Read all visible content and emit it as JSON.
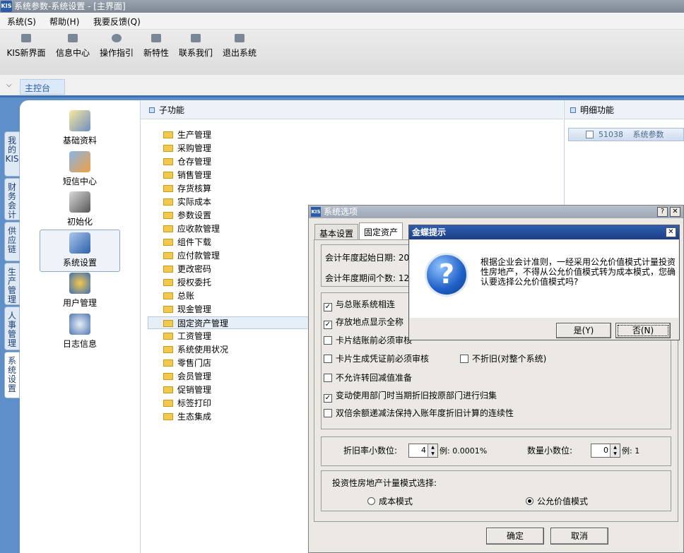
{
  "window": {
    "title": "系统参数-系统设置 - [主界面]",
    "logo": "KIS"
  },
  "menu": [
    "系统(S)",
    "帮助(H)",
    "我要反馈(Q)"
  ],
  "toolbar": [
    "KIS新界面",
    "信息中心",
    "操作指引",
    "新特性",
    "联系我们",
    "退出系统"
  ],
  "main_tab": "主控台",
  "vertical_tabs": [
    "我的KIS",
    "财务会计",
    "供应链",
    "生产管理",
    "人事管理",
    "系统设置"
  ],
  "nav_items": [
    "基础资料",
    "短信中心",
    "初始化",
    "系统设置",
    "用户管理",
    "日志信息"
  ],
  "sub_function": {
    "header": "子功能",
    "folders": [
      "生产管理",
      "采购管理",
      "仓存管理",
      "销售管理",
      "存货核算",
      "实际成本",
      "参数设置",
      "应收款管理",
      "组件下载",
      "应付款管理",
      "更改密码",
      "授权委托",
      "总账",
      "现金管理",
      "固定资产管理",
      "工资管理",
      "系统使用状况",
      "零售门店",
      "会员管理",
      "促销管理",
      "标签打印",
      "生态集成"
    ],
    "selected": "固定资产管理"
  },
  "detail": {
    "header": "明细功能",
    "item_code": "51038",
    "item_label": "系统参数"
  },
  "options_dialog": {
    "title": "系统选项",
    "logo": "KIS",
    "tabs": [
      "基本设置",
      "固定资产"
    ],
    "start_date_label": "会计年度起始日期: 20",
    "period_count_label": "会计年度期间个数: 12",
    "checkboxes": [
      {
        "label": "与总账系统相连",
        "checked": true
      },
      {
        "label": "存放地点显示全称",
        "checked": true
      },
      {
        "label": "卡片结账前必须审核",
        "checked": false
      },
      {
        "label": "卡片生成凭证前必须审核",
        "checked": false
      },
      {
        "label": "不折旧(对整个系统)",
        "checked": false
      },
      {
        "label": "不允许转回减值准备",
        "checked": false
      },
      {
        "label": "变动使用部门时当期折旧按原部门进行归集",
        "checked": true
      },
      {
        "label": "双倍余额递减法保持入账年度折旧计算的连续性",
        "checked": false
      }
    ],
    "depr_decimal_label": "折旧率小数位:",
    "depr_decimal_value": "4",
    "depr_example": "例: 0.0001%",
    "qty_decimal_label": "数量小数位:",
    "qty_decimal_value": "0",
    "qty_example": "例: 1",
    "invest_label": "投资性房地产计量模式选择:",
    "radio_cost": "成本模式",
    "radio_fair": "公允价值模式",
    "selected_mode": "公允价值模式",
    "ok": "确定",
    "cancel": "取消"
  },
  "prompt_dialog": {
    "title": "金蝶提示",
    "message": "根据企业会计准则，一经采用公允价值模式计量投资性房地产，不得从公允价值模式转为成本模式，您确认要选择公允价值模式吗?",
    "yes": "是(Y)",
    "no": "否(N)",
    "icon_glyph": "?"
  },
  "colors": {
    "accent": "#2a5ca8",
    "titlebar": "#8a949f",
    "prompt_title": "#1b3f85"
  }
}
